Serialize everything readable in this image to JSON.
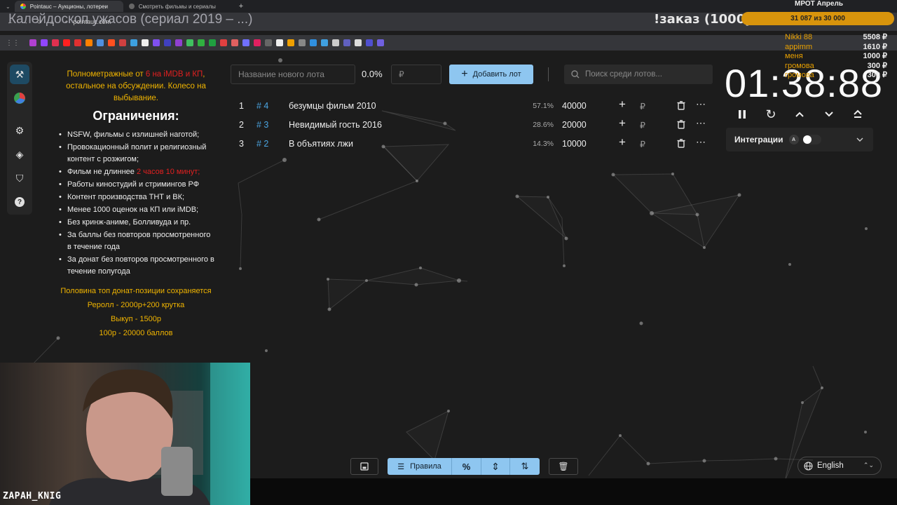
{
  "browser": {
    "tabs": [
      {
        "label": "Pointauc – Аукционы, лотереи",
        "active": true
      },
      {
        "label": "Смотреть фильмы и сериалы",
        "active": false
      }
    ],
    "url": "pointauc.com"
  },
  "overlay": {
    "title": "Калейдоскоп ужасов (сериал 2019 – ...)",
    "order": "!заказ (1000р)",
    "mrot_title": "МРОТ Апрель",
    "mrot_progress": "31 087  из 30 000",
    "donors": [
      {
        "name": "Nikki 88",
        "amount": "5508 ₽"
      },
      {
        "name": "appimm",
        "amount": "1610 ₽"
      },
      {
        "name": "меня",
        "amount": "1000 ₽"
      },
      {
        "name": "громова",
        "amount": "300 ₽"
      },
      {
        "name": "громова",
        "amount": "300 ₽"
      }
    ]
  },
  "rules": {
    "intro_part1": "Полнометражные от ",
    "intro_red": "6 на iMDB и КП",
    "intro_part2": ", остальное на обсуждении. Колесо на выбывание.",
    "heading": "Ограничения:",
    "items": [
      "NSFW, фильмы с излишней наготой;",
      "Провокационный полит и религиозный контент с розжигом;",
      "Фильм не длиннее ",
      "Работы киностудий и стримингов РФ",
      "Контент производства ТНТ и ВК;",
      "Менее 1000 оценок на КП или iMDB;",
      "Без кринж-аниме, Болливуда и пр.",
      "За баллы без повторов просмотренного в течение года",
      "За донат без повторов просмотренного в течение полугода"
    ],
    "item3_red": "2 часов 10 минут;",
    "notes": [
      "Половина топ донат-позиции сохраняется",
      "Реролл - 2000р+200 крутка",
      "Выкуп - 1500р",
      "100р - 20000 баллов"
    ]
  },
  "toolbar": {
    "lot_name_placeholder": "Название нового лота",
    "percent": "0.0%",
    "amount_placeholder": "₽",
    "add_label": "Добавить лот",
    "search_placeholder": "Поиск среди лотов..."
  },
  "lots": [
    {
      "index": "1",
      "id": "# 4",
      "name": "безумцы фильм 2010",
      "percent": "57.1%",
      "amount": "40000",
      "currency": "₽"
    },
    {
      "index": "2",
      "id": "# 3",
      "name": "Невидимый гость 2016",
      "percent": "28.6%",
      "amount": "20000",
      "currency": "₽"
    },
    {
      "index": "3",
      "id": "# 2",
      "name": "В объятиях лжи",
      "percent": "14.3%",
      "amount": "10000",
      "currency": "₽"
    }
  ],
  "timer": {
    "value": "01:38:88"
  },
  "integrations": {
    "label": "Интеграции",
    "badge": "A"
  },
  "bottom": {
    "rules_label": "Правила"
  },
  "language": {
    "label": "English"
  },
  "webcam": {
    "name": "ZAPAH_KNIG"
  },
  "colors": {
    "accent": "#8ec6f0",
    "gold": "#f0b400",
    "red": "#e02020",
    "link": "#4aa3df",
    "background": "#1c1c1c"
  }
}
